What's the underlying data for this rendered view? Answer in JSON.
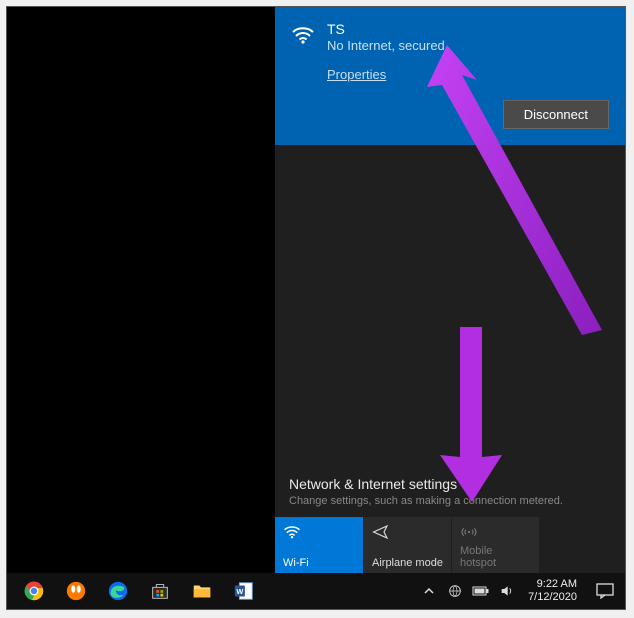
{
  "network": {
    "name": "TS",
    "status": "No Internet, secured",
    "properties_label": "Properties",
    "disconnect_label": "Disconnect"
  },
  "settings": {
    "heading": "Network & Internet settings",
    "sub": "Change settings, such as making a connection metered."
  },
  "tiles": {
    "wifi": "Wi-Fi",
    "airplane": "Airplane mode",
    "hotspot": "Mobile hotspot"
  },
  "tray": {
    "time": "9:22 AM",
    "date": "7/12/2020"
  }
}
